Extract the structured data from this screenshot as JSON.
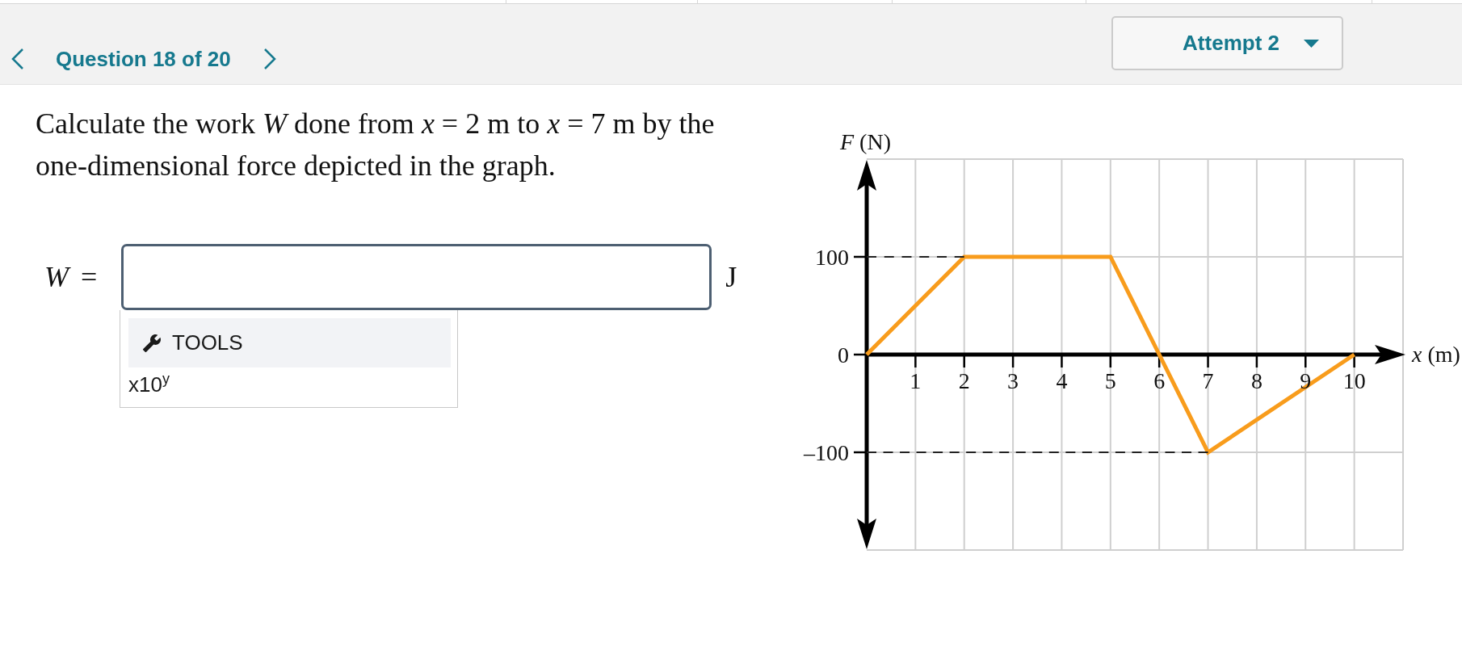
{
  "header": {
    "question_label": "Question 18 of 20",
    "attempt_dropdown": "Attempt 2"
  },
  "question": {
    "prompt": "Calculate the work *W* done from *x* = 2 m to *x* = 7 m by the one-dimensional force depicted in the graph.",
    "answer": {
      "label": "*W* =",
      "unit": "J"
    },
    "tools": {
      "button": "TOOLS",
      "items": [
        {
          "kind": "exponent",
          "label": "x10$^{y}$"
        }
      ]
    }
  },
  "graph": {
    "chart_data": {
      "type": "line",
      "xlabel": "*x* (m)",
      "ylabel": "*F* (N)",
      "x": [
        0,
        2,
        5,
        6,
        7,
        10
      ],
      "series": [
        {
          "color": "#f89c1c",
          "line_style": "solid",
          "values": [
            0,
            100,
            100,
            0,
            -100,
            0
          ]
        },
        {
          "color": "#222222",
          "line_style": "dashed",
          "values": [
            100,
            100,
            null,
            null,
            null,
            null
          ]
        },
        {
          "color": "#222222",
          "line_style": "dashed",
          "values": [
            -100,
            -100,
            -100,
            -100,
            -100,
            null
          ]
        }
      ],
      "xlim": [
        0,
        11
      ],
      "ylim": [
        -200,
        200
      ],
      "xticks": [
        1,
        2,
        3,
        4,
        5,
        6,
        7,
        8,
        9,
        10
      ],
      "yticks": [
        {
          "value": -100,
          "label": "–100"
        },
        0,
        100
      ],
      "grid": true
    }
  }
}
